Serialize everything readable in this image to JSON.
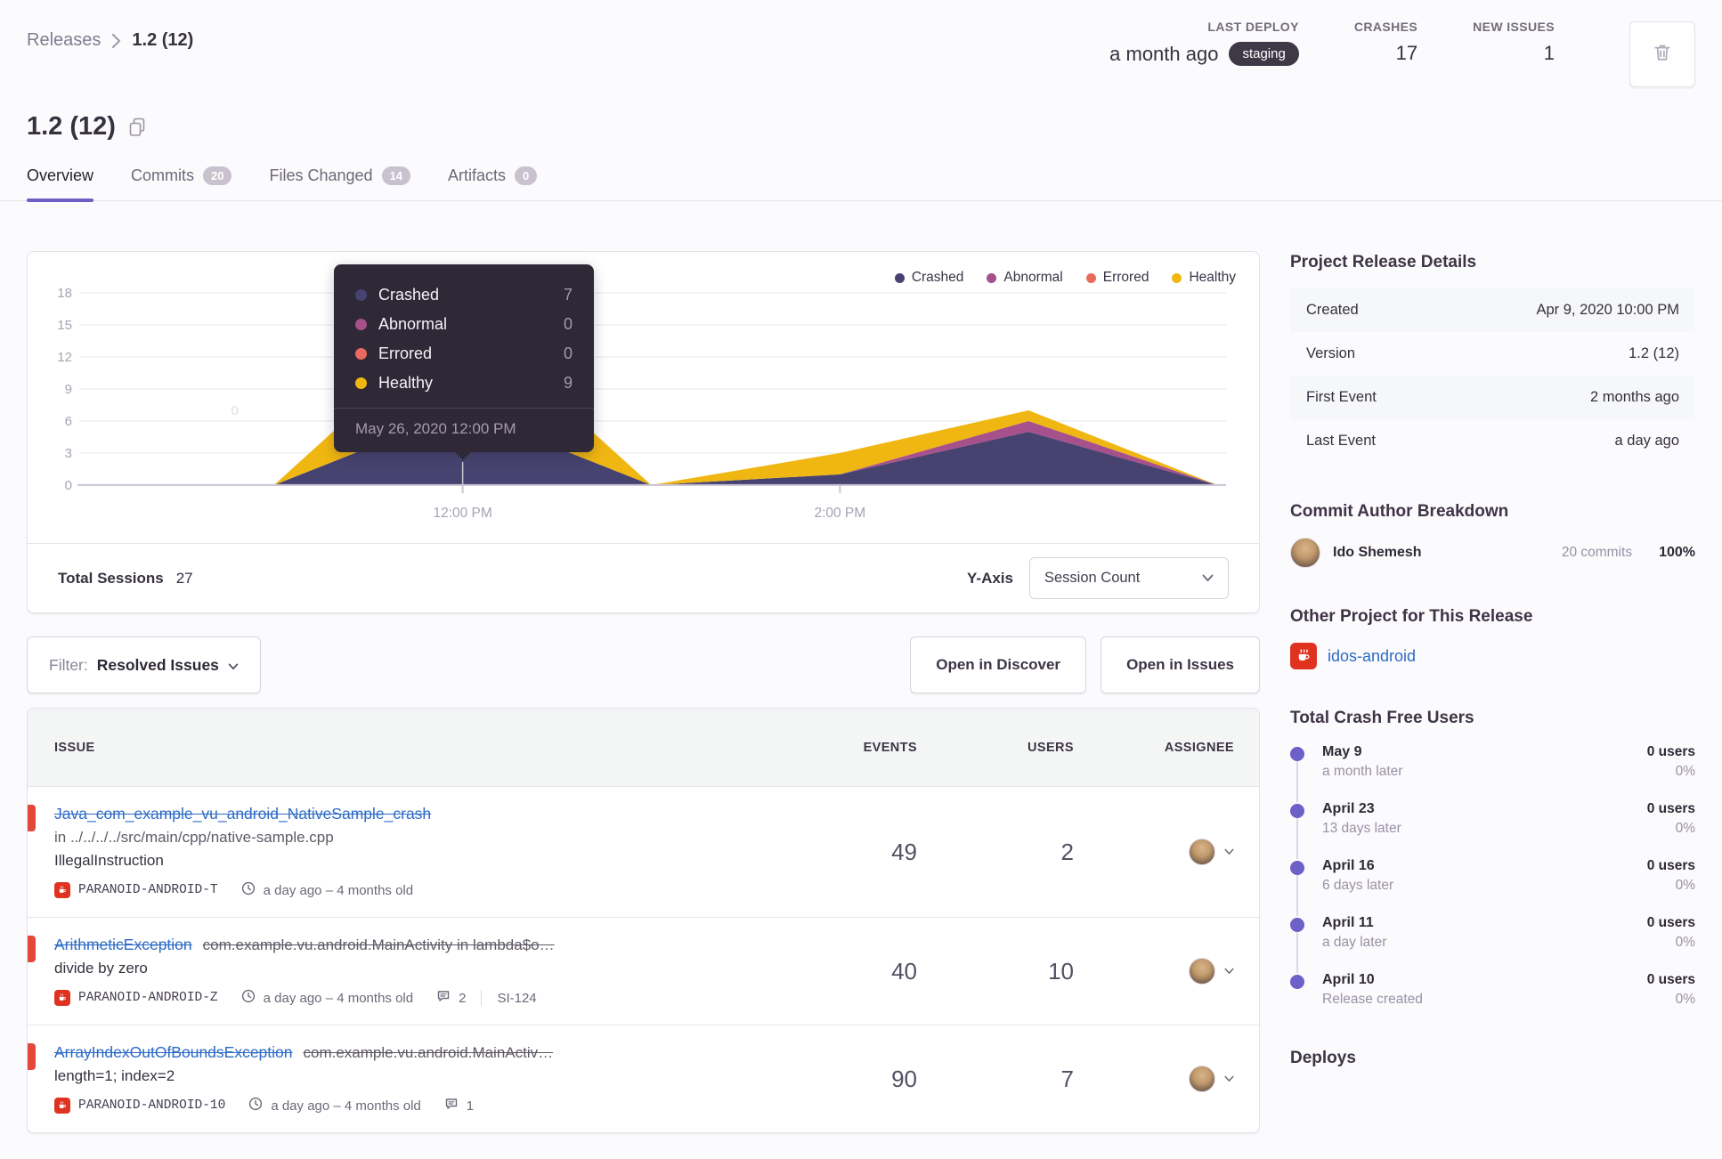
{
  "breadcrumb": {
    "releases": "Releases",
    "current": "1.2 (12)"
  },
  "header": {
    "last_deploy_label": "LAST DEPLOY",
    "last_deploy_value": "a month ago",
    "last_deploy_env": "staging",
    "crashes_label": "CRASHES",
    "crashes_value": "17",
    "new_issues_label": "NEW ISSUES",
    "new_issues_value": "1"
  },
  "title": "1.2 (12)",
  "tabs": [
    {
      "label": "Overview"
    },
    {
      "label": "Commits",
      "badge": "20"
    },
    {
      "label": "Files Changed",
      "badge": "14"
    },
    {
      "label": "Artifacts",
      "badge": "0"
    }
  ],
  "chart_footer": {
    "total_sessions_label": "Total Sessions",
    "total_sessions_value": "27",
    "y_axis_label": "Y-Axis",
    "y_axis_value": "Session Count"
  },
  "filter_bar": {
    "filter_label": "Filter:",
    "filter_value": "Resolved Issues",
    "open_in_discover": "Open in Discover",
    "open_in_issues": "Open in Issues"
  },
  "issues_table": {
    "columns": [
      "ISSUE",
      "EVENTS",
      "USERS",
      "ASSIGNEE"
    ],
    "rows": [
      {
        "title": "Java_com_example_vu_android_NativeSample_crash",
        "subtitle": "in ../../../../src/main/cpp/native-sample.cpp",
        "message": "IllegalInstruction",
        "project": "PARANOID-ANDROID-T",
        "age": "a day ago – 4 months old",
        "events": "49",
        "users": "2"
      },
      {
        "title": "ArithmeticException",
        "culprit": "com.example.vu.android.MainActivity in lambda$o…",
        "message": "divide by zero",
        "project": "PARANOID-ANDROID-Z",
        "age": "a day ago – 4 months old",
        "comments": "2",
        "ticket": "SI-124",
        "events": "40",
        "users": "10"
      },
      {
        "title": "ArrayIndexOutOfBoundsException",
        "culprit": "com.example.vu.android.MainActiv…",
        "message": "length=1; index=2",
        "project": "PARANOID-ANDROID-10",
        "age": "a day ago – 4 months old",
        "comments": "1",
        "events": "90",
        "users": "7"
      }
    ]
  },
  "sidebar": {
    "release_details": {
      "title": "Project Release Details",
      "rows": [
        {
          "label": "Created",
          "value": "Apr 9, 2020 10:00 PM"
        },
        {
          "label": "Version",
          "value": "1.2 (12)"
        },
        {
          "label": "First Event",
          "value": "2 months ago"
        },
        {
          "label": "Last Event",
          "value": "a day ago"
        }
      ]
    },
    "commit_authors": {
      "title": "Commit Author Breakdown",
      "name": "Ido Shemesh",
      "commits": "20 commits",
      "percent": "100%"
    },
    "other_project": {
      "title": "Other Project for This Release",
      "name": "idos-android"
    },
    "crash_free": {
      "title": "Total Crash Free Users",
      "items": [
        {
          "date": "May 9",
          "sub": "a month later",
          "users": "0 users",
          "pct": "0%"
        },
        {
          "date": "April 23",
          "sub": "13 days later",
          "users": "0 users",
          "pct": "0%"
        },
        {
          "date": "April 16",
          "sub": "6 days later",
          "users": "0 users",
          "pct": "0%"
        },
        {
          "date": "April 11",
          "sub": "a day later",
          "users": "0 users",
          "pct": "0%"
        },
        {
          "date": "April 10",
          "sub": "Release created",
          "users": "0 users",
          "pct": "0%"
        }
      ]
    },
    "deploys_title": "Deploys"
  },
  "chart_data": {
    "type": "area",
    "stacked": true,
    "x": [
      "10:00 AM",
      "11:00 AM",
      "12:00 PM",
      "1:00 PM",
      "2:00 PM",
      "3:00 PM",
      "4:00 PM"
    ],
    "series": [
      {
        "name": "Crashed",
        "color": "#474370",
        "values": [
          0,
          0,
          7,
          0,
          1,
          5,
          0
        ]
      },
      {
        "name": "Abnormal",
        "color": "#A6508C",
        "values": [
          0,
          0,
          0,
          0,
          0,
          1,
          0
        ]
      },
      {
        "name": "Errored",
        "color": "#EA6B5E",
        "values": [
          0,
          0,
          0,
          0,
          0,
          0,
          0
        ]
      },
      {
        "name": "Healthy",
        "color": "#F0B712",
        "values": [
          0,
          0,
          9,
          0,
          2,
          1,
          0
        ]
      }
    ],
    "y_ticks": [
      0,
      3,
      6,
      9,
      12,
      15,
      18
    ],
    "ylim": [
      0,
      19
    ],
    "x_ticks_visible": [
      "12:00 PM",
      "2:00 PM"
    ],
    "x_tick_indices": [
      2,
      4
    ],
    "grid": true,
    "legend_position": "top-right",
    "hover_index": 2,
    "tooltip": {
      "date": "May 26, 2020 12:00 PM",
      "rows": [
        {
          "label": "Crashed",
          "value": "7"
        },
        {
          "label": "Abnormal",
          "value": "0"
        },
        {
          "label": "Errored",
          "value": "0"
        },
        {
          "label": "Healthy",
          "value": "9"
        }
      ]
    }
  }
}
